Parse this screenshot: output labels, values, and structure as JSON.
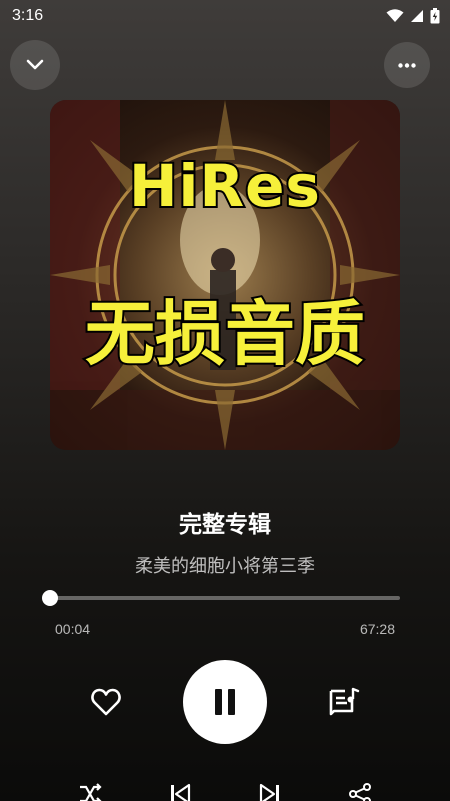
{
  "status_bar": {
    "time": "3:16",
    "icons": [
      "wifi-icon",
      "signal-icon",
      "battery-icon"
    ]
  },
  "header": {
    "collapse_icon": "chevron-down-icon",
    "more_icon": "more-horizontal-icon"
  },
  "album_cover": {
    "line1": "HiRes",
    "line2": "无损音质"
  },
  "track": {
    "title": "完整专辑",
    "artist": "柔美的细胞小将第三季"
  },
  "progress": {
    "elapsed": "00:04",
    "total": "67:28",
    "fraction": 0.001
  },
  "controls": {
    "like_icon": "heart-outline-icon",
    "play_state_icon": "pause-icon",
    "queue_icon": "lyrics-queue-icon",
    "shuffle_icon": "shuffle-icon",
    "prev_icon": "skip-previous-icon",
    "next_icon": "skip-next-icon",
    "share_icon": "share-icon"
  },
  "colors": {
    "cover_text": "#f6f03a",
    "play_button": "#ffffff"
  }
}
